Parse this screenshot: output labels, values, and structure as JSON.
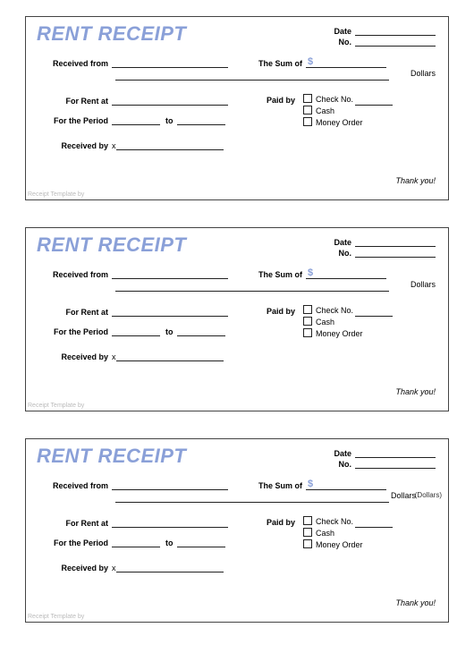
{
  "receipt": {
    "title": "RENT RECEIPT",
    "date_label": "Date",
    "no_label": "No.",
    "received_from_label": "Received from",
    "the_sum_of_label": "The Sum of",
    "currency_symbol": "$",
    "dollars_word": "Dollars",
    "for_rent_at_label": "For Rent at",
    "paid_by_label": "Paid by",
    "check_no_label": "Check No.",
    "cash_label": "Cash",
    "money_order_label": "Money Order",
    "for_period_label": "For the Period",
    "to_label": "to",
    "received_by_label": "Received by",
    "signature_x": "x",
    "thank_you": "Thank you!",
    "footer_credit": "Receipt Template by"
  },
  "overlay_text": "(Dollars)"
}
